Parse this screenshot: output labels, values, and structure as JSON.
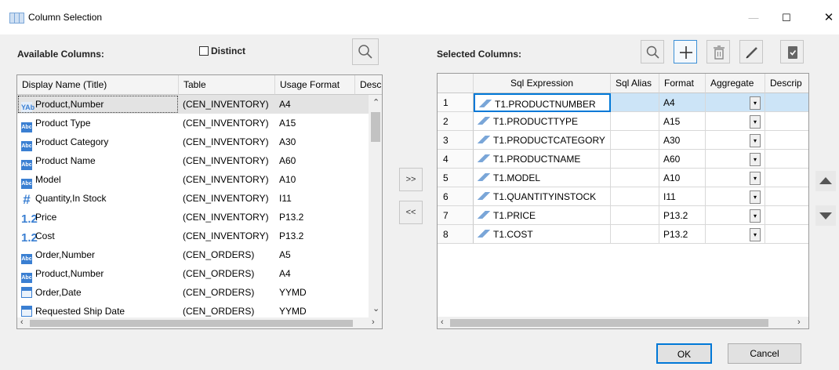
{
  "window": {
    "title": "Column Selection",
    "min_glyph": "—",
    "max_glyph": "☐",
    "close_glyph": "✕"
  },
  "left": {
    "label": "Available Columns:",
    "distinct_label": "Distinct",
    "distinct_checked": false,
    "columns": [
      "Display Name (Title)",
      "Table",
      "Usage Format",
      "Desc"
    ],
    "rows": [
      {
        "icon": "yab",
        "icon_text": "YAb",
        "name": "Product,Number",
        "table": "(CEN_INVENTORY)",
        "format": "A4"
      },
      {
        "icon": "abc",
        "icon_text": "Abc",
        "name": "Product Type",
        "table": "(CEN_INVENTORY)",
        "format": "A15"
      },
      {
        "icon": "abc",
        "icon_text": "Abc",
        "name": "Product Category",
        "table": "(CEN_INVENTORY)",
        "format": "A30"
      },
      {
        "icon": "abc",
        "icon_text": "Abc",
        "name": "Product Name",
        "table": "(CEN_INVENTORY)",
        "format": "A60"
      },
      {
        "icon": "abc",
        "icon_text": "Abc",
        "name": "Model",
        "table": "(CEN_INVENTORY)",
        "format": "A10"
      },
      {
        "icon": "hash",
        "icon_text": "#",
        "name": "Quantity,In Stock",
        "table": "(CEN_INVENTORY)",
        "format": "I11"
      },
      {
        "icon": "dec",
        "icon_text": "1.2",
        "name": "Price",
        "table": "(CEN_INVENTORY)",
        "format": "P13.2"
      },
      {
        "icon": "dec",
        "icon_text": "1.2",
        "name": "Cost",
        "table": "(CEN_INVENTORY)",
        "format": "P13.2"
      },
      {
        "icon": "abc",
        "icon_text": "Abc",
        "name": "Order,Number",
        "table": "(CEN_ORDERS)",
        "format": "A5"
      },
      {
        "icon": "abc",
        "icon_text": "Abc",
        "name": "Product,Number",
        "table": "(CEN_ORDERS)",
        "format": "A4"
      },
      {
        "icon": "dateic",
        "icon_text": "",
        "name": "Order,Date",
        "table": "(CEN_ORDERS)",
        "format": "YYMD"
      },
      {
        "icon": "dateic",
        "icon_text": "",
        "name": "Requested Ship Date",
        "table": "(CEN_ORDERS)",
        "format": "YYMD"
      }
    ]
  },
  "move": {
    "add": ">>",
    "remove": "<<"
  },
  "right": {
    "label": "Selected Columns:",
    "columns": [
      "Sql Expression",
      "Sql Alias",
      "Format",
      "Aggregate",
      "Descrip"
    ],
    "rows": [
      {
        "n": "1",
        "expr": "T1.PRODUCTNUMBER",
        "alias": "",
        "format": "A4"
      },
      {
        "n": "2",
        "expr": "T1.PRODUCTTYPE",
        "alias": "",
        "format": "A15"
      },
      {
        "n": "3",
        "expr": "T1.PRODUCTCATEGORY",
        "alias": "",
        "format": "A30"
      },
      {
        "n": "4",
        "expr": "T1.PRODUCTNAME",
        "alias": "",
        "format": "A60"
      },
      {
        "n": "5",
        "expr": "T1.MODEL",
        "alias": "",
        "format": "A10"
      },
      {
        "n": "6",
        "expr": "T1.QUANTITYINSTOCK",
        "alias": "",
        "format": "I11"
      },
      {
        "n": "7",
        "expr": "T1.PRICE",
        "alias": "",
        "format": "P13.2"
      },
      {
        "n": "8",
        "expr": "T1.COST",
        "alias": "",
        "format": "P13.2"
      }
    ],
    "dropdown_glyph": "▾"
  },
  "buttons": {
    "ok": "OK",
    "cancel": "Cancel"
  },
  "colors": {
    "accent": "#3a7fd2",
    "selected_row": "#cce4f7",
    "focus_border": "#0078d7"
  }
}
